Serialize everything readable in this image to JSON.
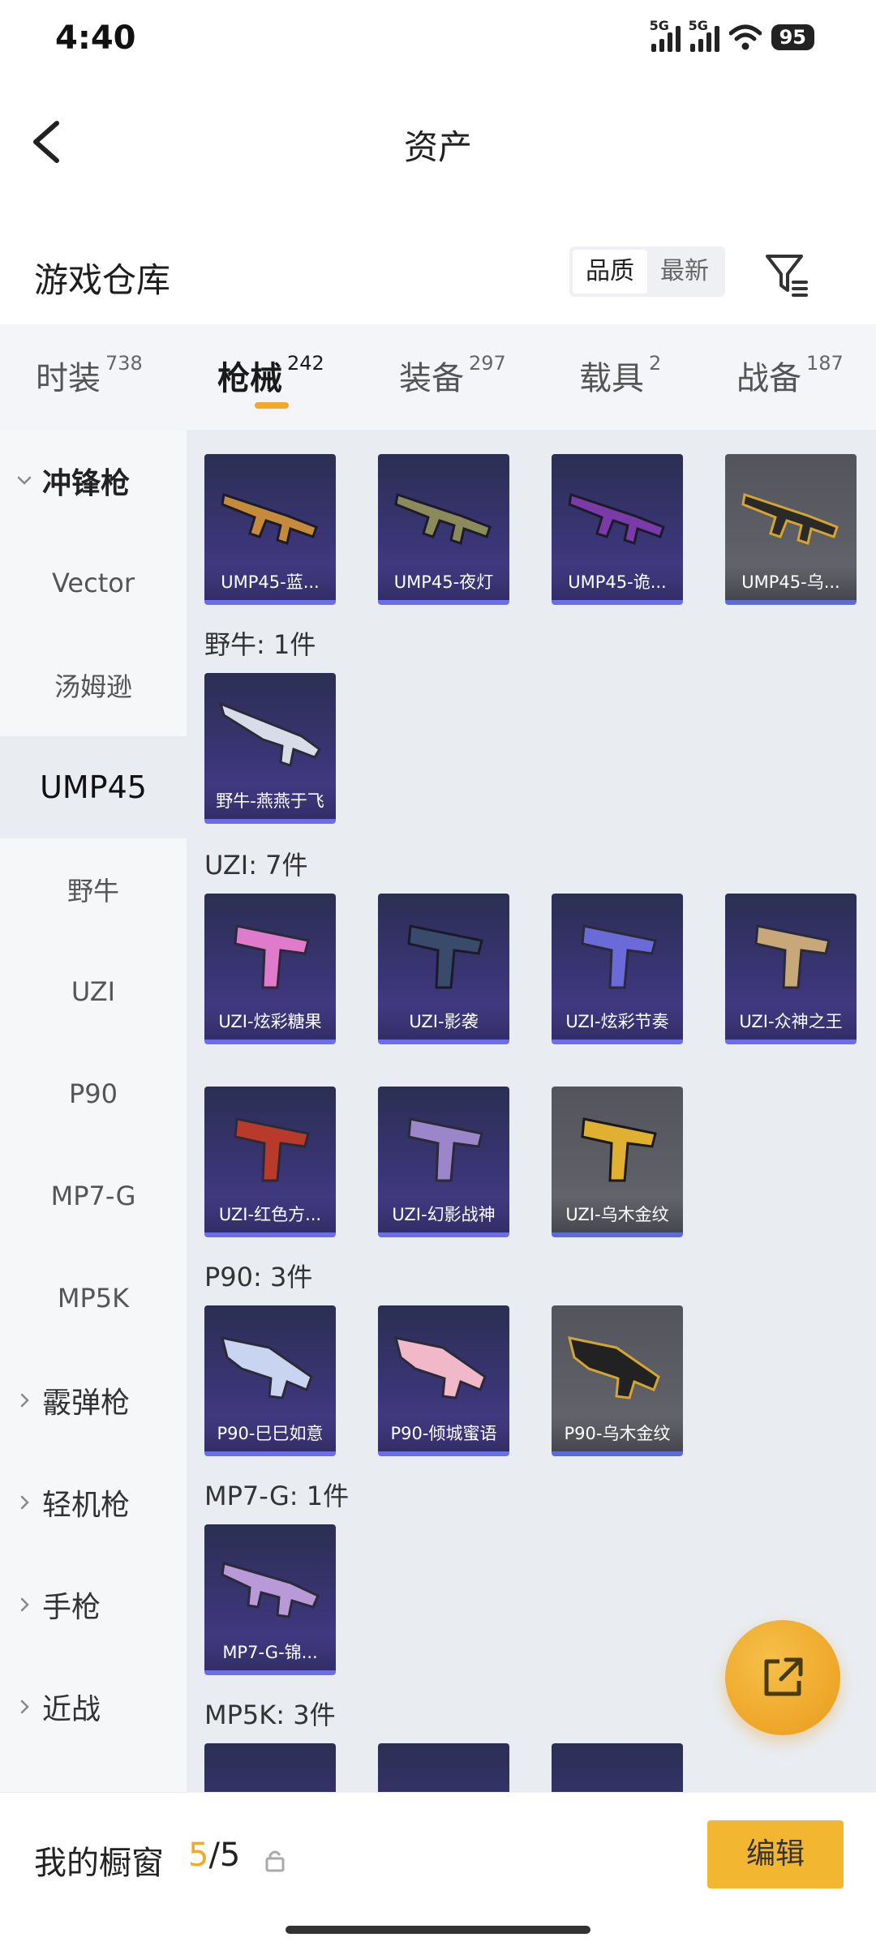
{
  "status_bar": {
    "time": "4:40",
    "battery": "95",
    "signal_labels": [
      "5G",
      "5G"
    ]
  },
  "header": {
    "title": "资产"
  },
  "warehouse": {
    "title": "游戏仓库",
    "sort_options": [
      "品质",
      "最新"
    ],
    "active_sort": "品质"
  },
  "category_tabs": [
    {
      "label": "时装",
      "count": "738"
    },
    {
      "label": "枪械",
      "count": "242",
      "active": true
    },
    {
      "label": "装备",
      "count": "297"
    },
    {
      "label": "载具",
      "count": "2"
    },
    {
      "label": "战备",
      "count": "187"
    }
  ],
  "sidebar": {
    "items": [
      {
        "label": "冲锋枪",
        "type": "group",
        "expanded": true
      },
      {
        "label": "Vector"
      },
      {
        "label": "汤姆逊"
      },
      {
        "label": "UMP45",
        "active": true
      },
      {
        "label": "野牛"
      },
      {
        "label": "UZI"
      },
      {
        "label": "P90"
      },
      {
        "label": "MP7-G"
      },
      {
        "label": "MP5K"
      },
      {
        "label": "霰弹枪",
        "type": "group"
      },
      {
        "label": "轻机枪",
        "type": "group"
      },
      {
        "label": "手枪",
        "type": "group"
      },
      {
        "label": "近战",
        "type": "group"
      }
    ]
  },
  "sections": {
    "ump45": {
      "items": [
        "UMP45-蓝...",
        "UMP45-夜灯",
        "UMP45-诡...",
        "UMP45-乌..."
      ]
    },
    "bizon": {
      "label": "野牛: 1件",
      "items": [
        "野牛-燕燕于飞"
      ]
    },
    "uzi": {
      "label": "UZI: 7件",
      "items": [
        "UZI-炫彩糖果",
        "UZI-影袭",
        "UZI-炫彩节奏",
        "UZI-众神之王",
        "UZI-红色方...",
        "UZI-幻影战神",
        "UZI-乌木金纹"
      ]
    },
    "p90": {
      "label": "P90: 3件",
      "items": [
        "P90-巳巳如意",
        "P90-倾城蜜语",
        "P90-乌木金纹"
      ]
    },
    "mp7g": {
      "label": "MP7-G: 1件",
      "items": [
        "MP7-G-锦..."
      ]
    },
    "mp5k": {
      "label": "MP5K: 3件",
      "items": [
        "",
        "",
        ""
      ]
    }
  },
  "bottom_bar": {
    "label": "我的橱窗",
    "current": "5",
    "total": "/5",
    "edit_label": "编辑"
  },
  "colors": {
    "accent": "#f0a92a",
    "edit_button": "#f3b631",
    "card_purple": "#3b3577",
    "card_gold": "#5e5f66"
  }
}
